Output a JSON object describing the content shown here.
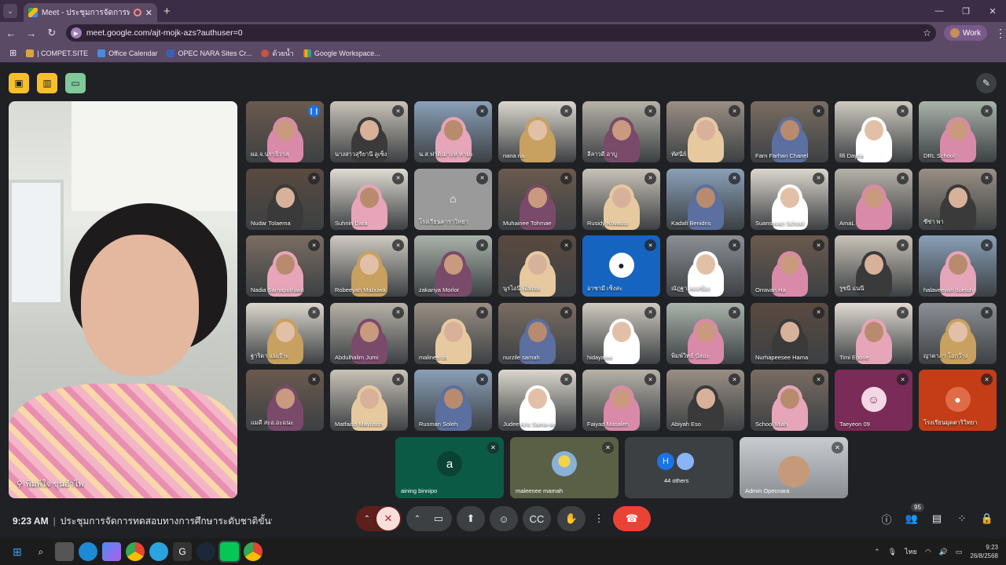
{
  "browser": {
    "tab_title": "Meet - ประชุมการจัดการทดสอบ",
    "url": "meet.google.com/ajt-mojk-azs?authuser=0",
    "profile": "Work",
    "bookmarks": [
      "| COMPET.SITE",
      "Office Calendar",
      "OPEC NARA Sites Cr...",
      "ด้วยน้ำ",
      "Google Workspace..."
    ]
  },
  "main_speaker": {
    "name": "พิมพ์ใจ ขุนอำไพ"
  },
  "tiles": [
    {
      "name": "ผอ.จ.นราธิวาส"
    },
    {
      "name": "นางสาวสุรียานี ลูเซ็ง"
    },
    {
      "name": "น.ส.ฟาตีเมาะห์ หามะ"
    },
    {
      "name": "nana na"
    },
    {
      "name": "ลีลาวดี อาบู"
    },
    {
      "name": "ทัศนีย์"
    },
    {
      "name": "Farn Farhan Chanel"
    },
    {
      "name": "fifi Dayrie"
    },
    {
      "name": "DRL School"
    },
    {
      "name": "Nudar Tolaema"
    },
    {
      "name": "Suhnin Dara"
    },
    {
      "name": "โรงเรียนตาราวิทยา"
    },
    {
      "name": "Muhainee Tohmae"
    },
    {
      "name": "Rusidy Kovautu"
    },
    {
      "name": "Kadafi Benidris"
    },
    {
      "name": "Suansavan School"
    },
    {
      "name": "AmaL"
    },
    {
      "name": "ซีซ่า พา"
    },
    {
      "name": "Nadia Samaputhakit"
    },
    {
      "name": "Robeeyah Mabuwa"
    },
    {
      "name": "zakariya Morlor"
    },
    {
      "name": "นูรไอนี เอ็มเมะ"
    },
    {
      "name": "อาซามี เซ็งสะ"
    },
    {
      "name": "ณัฎฐา ลดลชื่อง"
    },
    {
      "name": "Orravan Ha"
    },
    {
      "name": "รูซนี แนนี"
    },
    {
      "name": "halaveeyah dueloh"
    },
    {
      "name": "ฐาริดา แมเร๊าะ"
    },
    {
      "name": "Abdulhalim Jumi"
    },
    {
      "name": "malinee cn"
    },
    {
      "name": "nurzile samah"
    },
    {
      "name": "hidayatee"
    },
    {
      "name": "พิมพ์วิทย์ บัลอะ"
    },
    {
      "name": "Nurhapeesee Hama"
    },
    {
      "name": "Timi Epone"
    },
    {
      "name": "ญาดาภา โอกว๊าง"
    },
    {
      "name": "แมดี สะอ.อะแนะ"
    },
    {
      "name": "Matfaiso Mayusoh"
    },
    {
      "name": "Rusman Soleh"
    },
    {
      "name": "Judee Aris Sama-ae"
    },
    {
      "name": "Faiyad Masaleh"
    },
    {
      "name": "Abiyah Eso"
    },
    {
      "name": "School Miah"
    },
    {
      "name": "Taeyeon 09"
    },
    {
      "name": "โรงเรียนมุดตาริวิทยา"
    }
  ],
  "bottom_tiles": [
    {
      "name": "aining binnipo",
      "avatar": "a"
    },
    {
      "name": "maleenee mamah",
      "avatar": ""
    },
    {
      "name": "44 others",
      "avatar": "H"
    },
    {
      "name": "Admin Opecnara",
      "avatar": ""
    }
  ],
  "meeting": {
    "time": "9:23 AM",
    "title": "ประชุมการจัดการทดสอบทางการศึกษาระดับชาติขั้นพื้นฐาน (...",
    "participants_count": "95"
  },
  "taskbar": {
    "clock_time": "9:23",
    "clock_date": "26/8/2568",
    "lang": "ไทย"
  },
  "colors": {
    "end_call": "#ea4335",
    "mic_off": "#f9dedc",
    "accent_yellow": "#f7c02b",
    "accent_green": "#7fc99a"
  }
}
